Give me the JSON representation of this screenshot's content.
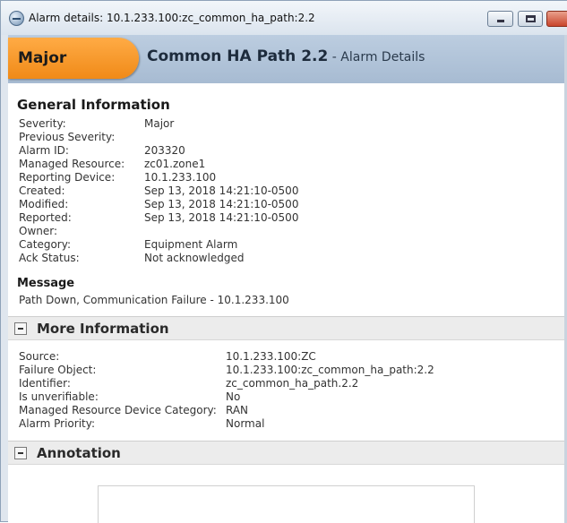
{
  "window": {
    "title": "Alarm details: 10.1.233.100:zc_common_ha_path:2.2"
  },
  "header": {
    "severity": "Major",
    "title": "Common HA Path 2.2",
    "subtitle": " - Alarm Details"
  },
  "general": {
    "title": "General Information",
    "rows": [
      {
        "label": "Severity:",
        "value": "Major"
      },
      {
        "label": "Previous Severity:",
        "value": ""
      },
      {
        "label": "Alarm ID:",
        "value": "203320"
      },
      {
        "label": "Managed Resource:",
        "value": "zc01.zone1"
      },
      {
        "label": "Reporting Device:",
        "value": "10.1.233.100"
      },
      {
        "label": "Created:",
        "value": "Sep 13, 2018 14:21:10-0500"
      },
      {
        "label": "Modified:",
        "value": "Sep 13, 2018 14:21:10-0500"
      },
      {
        "label": "Reported:",
        "value": "Sep 13, 2018 14:21:10-0500"
      },
      {
        "label": "Owner:",
        "value": ""
      },
      {
        "label": "Category:",
        "value": "Equipment Alarm"
      },
      {
        "label": "Ack Status:",
        "value": "Not acknowledged"
      }
    ]
  },
  "message": {
    "title": "Message",
    "text": "Path Down, Communication Failure - 10.1.233.100"
  },
  "more": {
    "title": "More Information",
    "rows": [
      {
        "label": "Source:",
        "value": "10.1.233.100:ZC"
      },
      {
        "label": "Failure Object:",
        "value": "10.1.233.100:zc_common_ha_path:2.2"
      },
      {
        "label": "Identifier:",
        "value": "zc_common_ha_path.2.2"
      },
      {
        "label": "Is unverifiable:",
        "value": "No"
      },
      {
        "label": "Managed Resource Device Category:",
        "value": "RAN"
      },
      {
        "label": "Alarm Priority:",
        "value": "Normal"
      }
    ]
  },
  "annotation": {
    "title": "Annotation"
  }
}
